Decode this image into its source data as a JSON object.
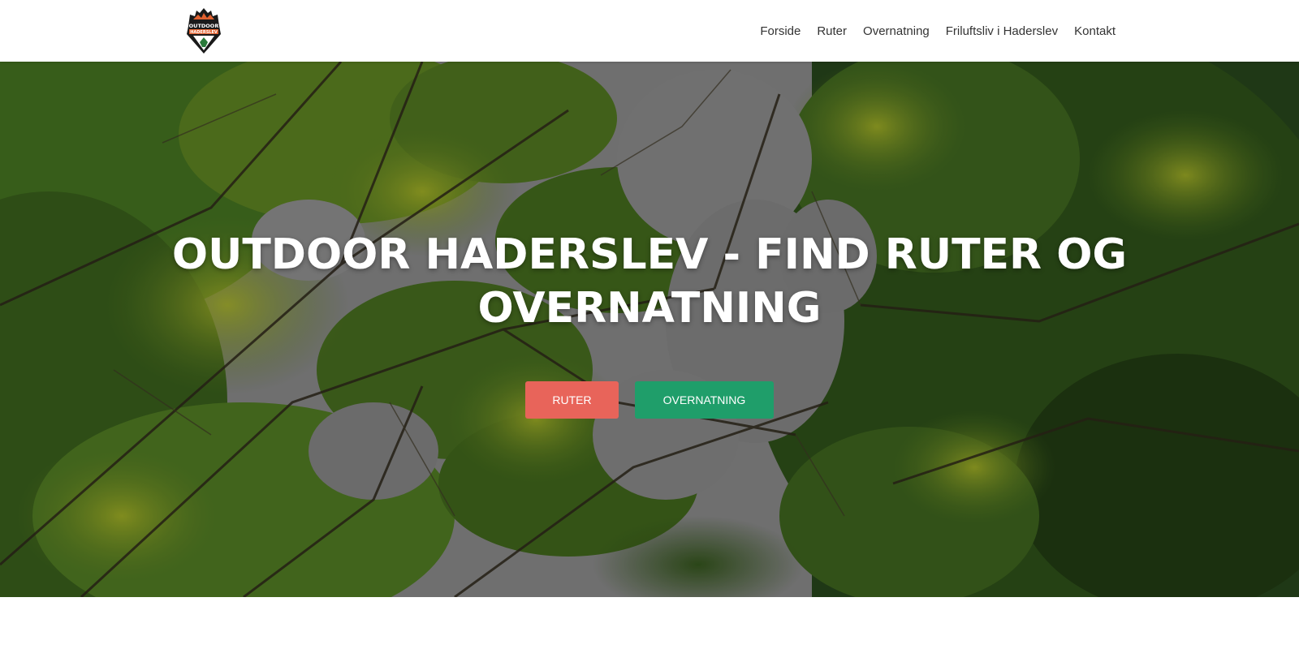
{
  "header": {
    "logo": {
      "icon": "outdoor-haderslev-logo",
      "text_top": "OUTDOOR",
      "text_bottom": "HADERSLEV"
    },
    "nav": [
      {
        "label": "Forside"
      },
      {
        "label": "Ruter"
      },
      {
        "label": "Overnatning"
      },
      {
        "label": "Friluftsliv i Haderslev"
      },
      {
        "label": "Kontakt"
      }
    ]
  },
  "hero": {
    "title_line1": "OUTDOOR HADERSLEV - FIND RUTER OG",
    "title_line2": "OVERNATNING",
    "buttons": [
      {
        "label": "RUTER",
        "color": "#e8645a"
      },
      {
        "label": "OVERNATNING",
        "color": "#1f9e6a"
      }
    ]
  },
  "colors": {
    "sky": "#7d7d7d",
    "foliage_dark": "#1f3a12",
    "foliage_mid": "#3d6a1f",
    "foliage_light": "#8a9a1e"
  }
}
